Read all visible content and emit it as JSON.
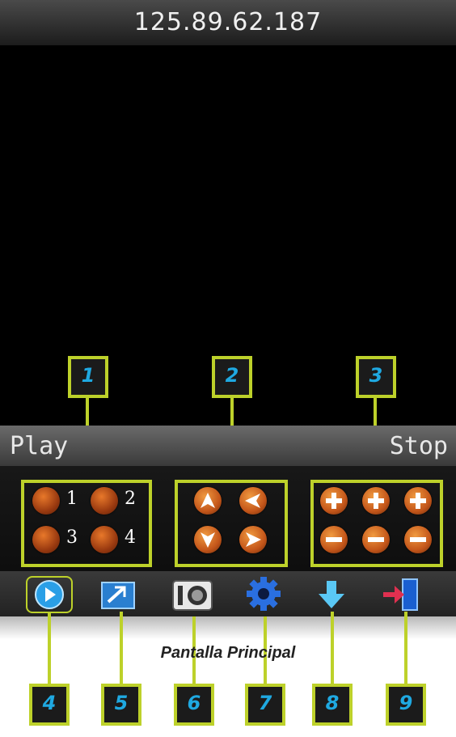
{
  "header": {
    "ip": "125.89.62.187"
  },
  "controls": {
    "play_label": "Play",
    "stop_label": "Stop"
  },
  "cameras": [
    "1",
    "2",
    "3",
    "4"
  ],
  "callouts": [
    "1",
    "2",
    "3",
    "4",
    "5",
    "6",
    "7",
    "8",
    "9"
  ],
  "caption": "Pantalla Principal",
  "colors": {
    "highlight": "#bdd12a",
    "callout_text": "#1fa9e1",
    "orb": "#c4561a"
  },
  "toolbar": {
    "icons": [
      "play-icon",
      "image-icon",
      "snapshot-camera-icon",
      "settings-gear-icon",
      "download-arrow-icon",
      "exit-icon"
    ]
  }
}
